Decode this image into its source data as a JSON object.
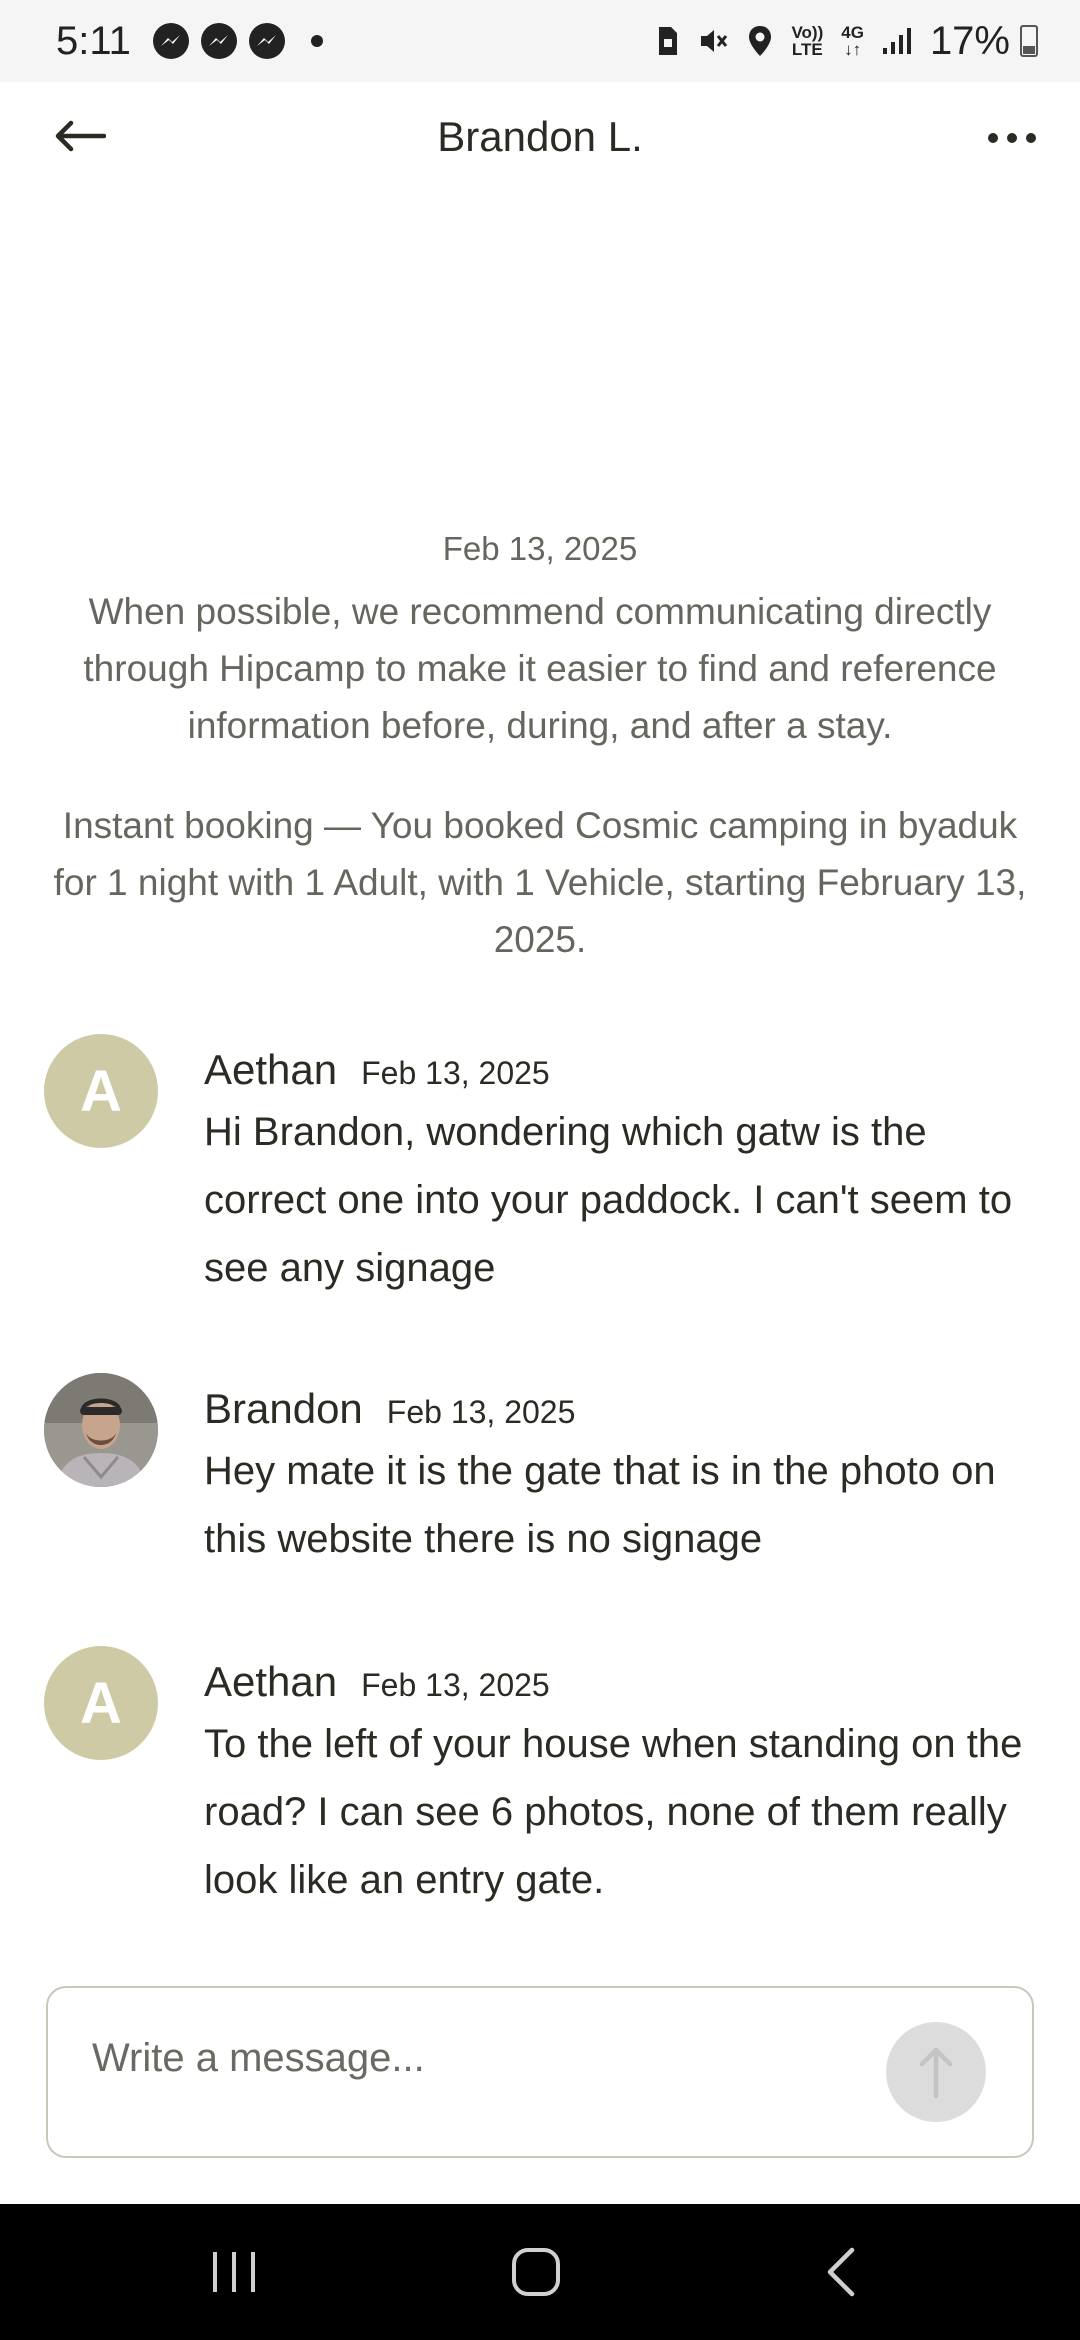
{
  "status_bar": {
    "time": "5:11",
    "volte_line1": "Vo))",
    "volte_line2": "LTE",
    "network": "4G",
    "battery": "17%"
  },
  "header": {
    "title": "Brandon L."
  },
  "system": {
    "date": "Feb 13, 2025",
    "note": "When possible, we recommend communicating directly through Hipcamp to make it easier to find and reference information before, during, and after a stay.",
    "booking": "Instant booking — You booked Cosmic camping in byaduk  for 1 night with 1 Adult, with 1 Vehicle, starting February 13, 2025."
  },
  "messages": [
    {
      "initial": "A",
      "sender": "Aethan",
      "date": "Feb 13, 2025",
      "text": "Hi Brandon, wondering which gatw is the correct one into your paddock. I can't seem to see any signage"
    },
    {
      "initial": "",
      "sender": "Brandon",
      "date": "Feb 13, 2025",
      "text": "Hey mate it is the gate that is in the photo on this website there is no signage"
    },
    {
      "initial": "A",
      "sender": "Aethan",
      "date": "Feb 13, 2025",
      "text": "To the left of your house when standing on the road? I can see 6 photos, none of them really look like an entry gate."
    }
  ],
  "composer": {
    "placeholder": "Write a message..."
  },
  "colors": {
    "avatar_bg": "#cfcaa6",
    "text_primary": "#2b2b24",
    "text_secondary": "#66665e",
    "send_button_bg": "#dcdcdc"
  }
}
